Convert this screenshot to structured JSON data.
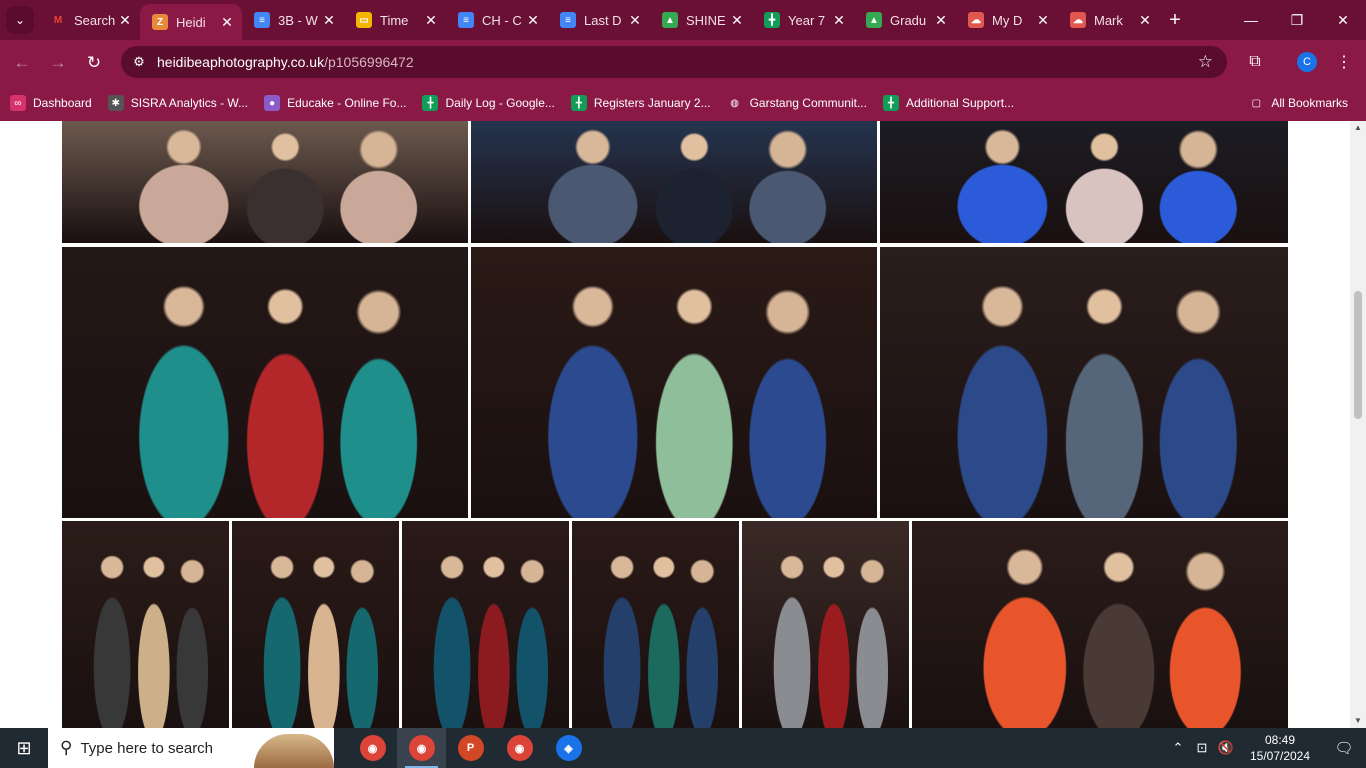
{
  "browser": {
    "tabs": [
      {
        "label": "Search",
        "icon": "gmail-icon",
        "color": "#ffffff",
        "glyph": "M",
        "active": false
      },
      {
        "label": "Heidi",
        "icon": "heidi-site-icon",
        "color": "#e8893a",
        "glyph": "Z",
        "active": true
      },
      {
        "label": "3B - W",
        "icon": "google-docs-icon",
        "color": "#4285f4",
        "glyph": "≡",
        "active": false
      },
      {
        "label": "Time",
        "icon": "google-slides-icon",
        "color": "#f4b400",
        "glyph": "▭",
        "active": false
      },
      {
        "label": "CH - C",
        "icon": "google-docs-icon",
        "color": "#4285f4",
        "glyph": "≡",
        "active": false
      },
      {
        "label": "Last D",
        "icon": "google-docs-icon",
        "color": "#4285f4",
        "glyph": "≡",
        "active": false
      },
      {
        "label": "SHINE",
        "icon": "google-drive-icon",
        "color": "#34a853",
        "glyph": "▲",
        "active": false
      },
      {
        "label": "Year 7",
        "icon": "google-sheets-icon",
        "color": "#0f9d58",
        "glyph": "╋",
        "active": false
      },
      {
        "label": "Gradu",
        "icon": "google-drive-icon",
        "color": "#34a853",
        "glyph": "▲",
        "active": false
      },
      {
        "label": "My D",
        "icon": "cloud-icon",
        "color": "#e0584f",
        "glyph": "☁",
        "active": false
      },
      {
        "label": "Mark",
        "icon": "cloud-icon",
        "color": "#e0584f",
        "glyph": "☁",
        "active": false
      }
    ],
    "close_glyph": "✕",
    "new_tab": "+",
    "window": {
      "minimize": "—",
      "restore": "❐",
      "close": "✕"
    },
    "nav": {
      "back": "←",
      "forward": "→",
      "reload": "↻"
    },
    "omnibox": {
      "domain": "heidibeaphotography.co.uk",
      "path": "/p1056996472",
      "tune": "⚙",
      "star": "☆"
    },
    "extensions": "⧉",
    "profile_initial": "C",
    "menu": "⋮",
    "bookmarks": [
      {
        "label": "Dashboard",
        "icon": "infinity-icon",
        "color": "#d6336c",
        "glyph": "∞"
      },
      {
        "label": "SISRA Analytics - W...",
        "icon": "sisra-icon",
        "color": "#555555",
        "glyph": "✱"
      },
      {
        "label": "Educake - Online Fo...",
        "icon": "educake-icon",
        "color": "#8a5cc7",
        "glyph": "●"
      },
      {
        "label": "Daily Log - Google...",
        "icon": "google-sheets-icon",
        "color": "#0f9d58",
        "glyph": "╋"
      },
      {
        "label": "Registers January 2...",
        "icon": "google-sheets-icon",
        "color": "#0f9d58",
        "glyph": "╋"
      },
      {
        "label": "Garstang Communit...",
        "icon": "globe-icon",
        "color": "#8a1946",
        "glyph": "◍"
      },
      {
        "label": "Additional Support...",
        "icon": "google-sheets-icon",
        "color": "#0f9d58",
        "glyph": "╋"
      }
    ],
    "all_bookmarks": {
      "label": "All Bookmarks",
      "glyph": "▢"
    }
  },
  "gallery": {
    "photos": [
      {
        "name": "photo-horse-carriage",
        "colors": [
          "#6d5a4f",
          "#c9a89a",
          "#3a3030"
        ]
      },
      {
        "name": "photo-boys-suits-top",
        "colors": [
          "#25344f",
          "#4a5872",
          "#1c2230"
        ]
      },
      {
        "name": "photo-girls-dresses-top",
        "colors": [
          "#1c1c24",
          "#2b5bd8",
          "#d9c3c0"
        ]
      },
      {
        "name": "photo-four-girls-gowns",
        "colors": [
          "#241816",
          "#1e8f8b",
          "#b3262a"
        ]
      },
      {
        "name": "photo-three-girls-blue-green",
        "colors": [
          "#2a1a16",
          "#2b4a8f",
          "#8fbf9a"
        ]
      },
      {
        "name": "photo-four-boys-blue-suits",
        "colors": [
          "#2a1e1c",
          "#2c4a8a",
          "#55667a"
        ]
      },
      {
        "name": "photo-girl-waistcoat",
        "colors": [
          "#2b1c18",
          "#383838",
          "#cbb08a"
        ]
      },
      {
        "name": "photo-two-girls-teal",
        "colors": [
          "#2a1a17",
          "#14686e",
          "#d8b590"
        ]
      },
      {
        "name": "photo-girl-teal-split-dress",
        "colors": [
          "#2a1a18",
          "#13536a",
          "#8b1b1e"
        ]
      },
      {
        "name": "photo-three-girls-sequins",
        "colors": [
          "#2a1a17",
          "#24406a",
          "#1a6a5e"
        ]
      },
      {
        "name": "photo-boy-hat-grey-suit",
        "colors": [
          "#3a2a26",
          "#8a8c92",
          "#9b1c1e"
        ]
      },
      {
        "name": "photo-three-girls-orange-sequin",
        "colors": [
          "#2b1c1a",
          "#e8552b",
          "#4a3a36"
        ]
      }
    ]
  },
  "taskbar": {
    "start": "⊞",
    "search_placeholder": "Type here to search",
    "search_glyph": "⚲",
    "apps": [
      {
        "name": "chrome-icon",
        "color": "#db4437",
        "glyph": "◉",
        "active": false
      },
      {
        "name": "chrome-profile-icon",
        "color": "#db4437",
        "glyph": "◉",
        "active": true
      },
      {
        "name": "powerpoint-icon",
        "color": "#d24726",
        "glyph": "P",
        "active": false
      },
      {
        "name": "chrome-alt-icon",
        "color": "#db4437",
        "glyph": "◉",
        "active": false
      },
      {
        "name": "maps-app-icon",
        "color": "#1a73e8",
        "glyph": "◈",
        "active": false
      }
    ],
    "tray": {
      "chevron": "⌃",
      "network": "⊡",
      "volume": "🔇",
      "notifications": "🗨"
    },
    "time": "08:49",
    "date": "15/07/2024"
  }
}
